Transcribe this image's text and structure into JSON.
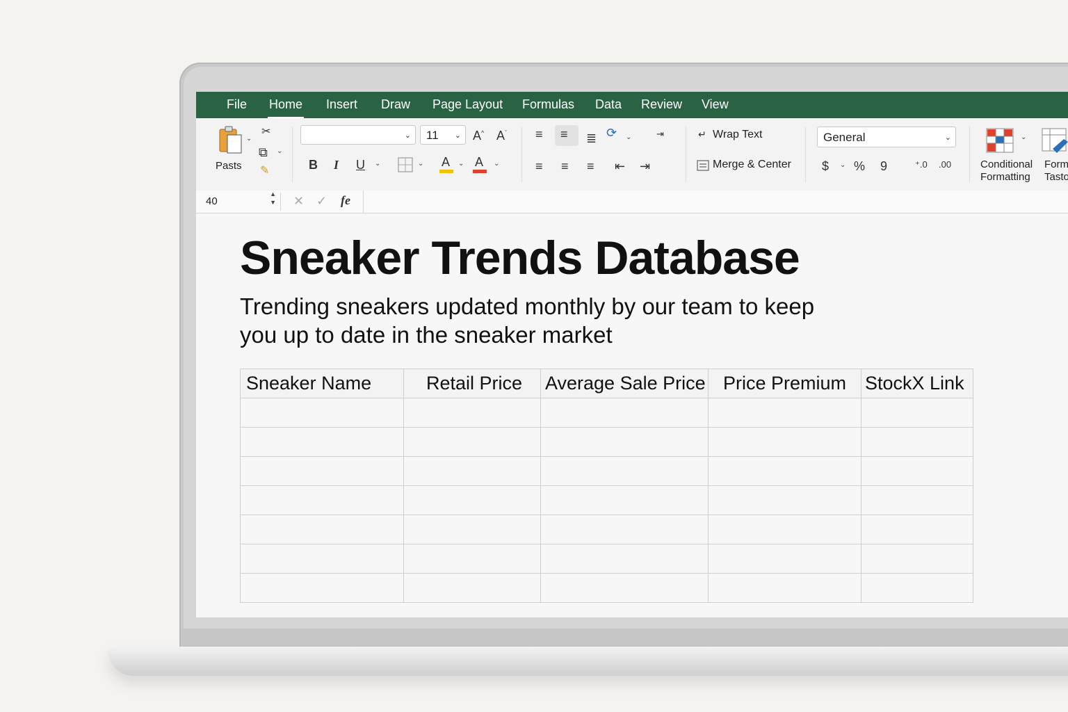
{
  "tabs": [
    "File",
    "Home",
    "Insert",
    "Draw",
    "Page Layout",
    "Formulas",
    "Data",
    "Review",
    "View"
  ],
  "active_tab": "Home",
  "ribbon": {
    "paste_label": "Pasts",
    "font_name": "",
    "font_size": "11",
    "bold": "B",
    "italic": "I",
    "underline": "U",
    "wrap_text": "Wrap Text",
    "merge_center": "Merge & Center",
    "number_format": "General",
    "percent": "%",
    "comma": "9",
    "conditional_formatting_line1": "Conditional",
    "conditional_formatting_line2": "Formatting",
    "format_table_line1": "Form",
    "format_table_line2": "Tasto"
  },
  "formula_bar": {
    "name_box": "40",
    "fx": "fe",
    "value": ""
  },
  "sheet": {
    "title": "Sneaker Trends Database",
    "subtitle": "Trending sneakers updated monthly by our team to keep you up to date in the sneaker market",
    "headers": [
      "Sneaker Name",
      "Retail Price",
      "Average Sale Price",
      "Price Premium",
      "StockX Link"
    ],
    "empty_rows": 7
  },
  "colors": {
    "tab_bar": "#2a6344",
    "accent_red": "#e0412c",
    "accent_yellow": "#f2c200"
  }
}
